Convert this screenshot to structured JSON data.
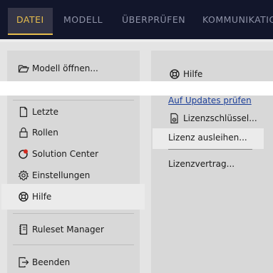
{
  "menubar": {
    "tabs": [
      {
        "label": "DATEI",
        "active": true
      },
      {
        "label": "MODELL"
      },
      {
        "label": "ÜBERPRÜFEN"
      },
      {
        "label": "KOMMUNIKATION"
      }
    ]
  },
  "left_menu": {
    "open_model": "Modell öffnen...",
    "recent": "Letzte",
    "roles": "Rollen",
    "solution_center": "Solution Center",
    "settings": "Einstellungen",
    "help": "Hilfe",
    "ruleset_manager": "Ruleset Manager",
    "exit": "Beenden"
  },
  "right_panel": {
    "heading": "Hilfe",
    "check_updates": "Auf Updates prüfen",
    "license_keys": "Lizenzschlüssel...",
    "borrow_license": "Lizenz ausleihen...",
    "license_agreement": "Lizenzvertrag..."
  },
  "colors": {
    "topbar_bg": "#12162b",
    "active_tab_text": "#e6bd4d",
    "inactive_tab_text": "#8f93a8",
    "link": "#1c3f99",
    "solution_center_dot": "#d22a1f"
  }
}
